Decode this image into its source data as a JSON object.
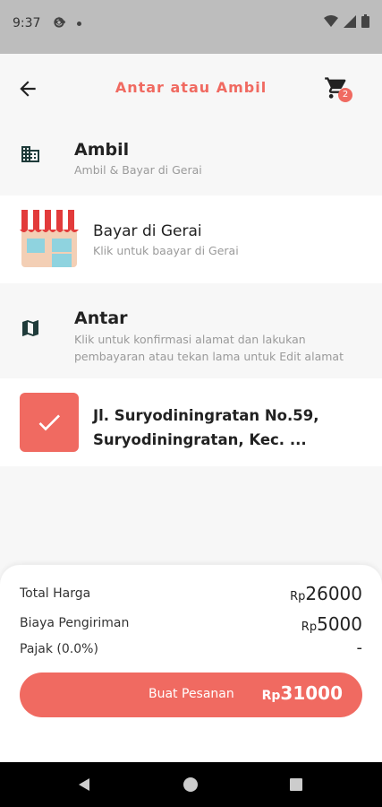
{
  "status_bar": {
    "time": "9:37"
  },
  "header": {
    "title": "Antar atau Ambil",
    "cart_count": "2"
  },
  "pickup_section": {
    "title": "Ambil",
    "subtitle": "Ambil & Bayar di Gerai"
  },
  "pickup_option": {
    "title": "Bayar di Gerai",
    "subtitle": "Klik untuk baayar di Gerai"
  },
  "delivery_section": {
    "title": "Antar",
    "subtitle_line1": "Klik untuk konfirmasi alamat dan lakukan",
    "subtitle_line2": "pembayaran atau tekan lama untuk Edit alamat"
  },
  "delivery_option": {
    "address_line1": "Jl. Suryodiningratan No.59,",
    "address_line2": "Suryodiningratan, Kec. ..."
  },
  "summary": {
    "currency": "Rp",
    "total_label": "Total Harga",
    "total_value": "26000",
    "shipping_label": "Biaya Pengiriman",
    "shipping_value": "5000",
    "tax_label": "Pajak (0.0%)",
    "tax_value": "-"
  },
  "order_button": {
    "label": "Buat Pesanan",
    "total": "31000"
  },
  "colors": {
    "accent": "#f06a61",
    "background": "#f7f7f7",
    "card": "#ffffff"
  }
}
